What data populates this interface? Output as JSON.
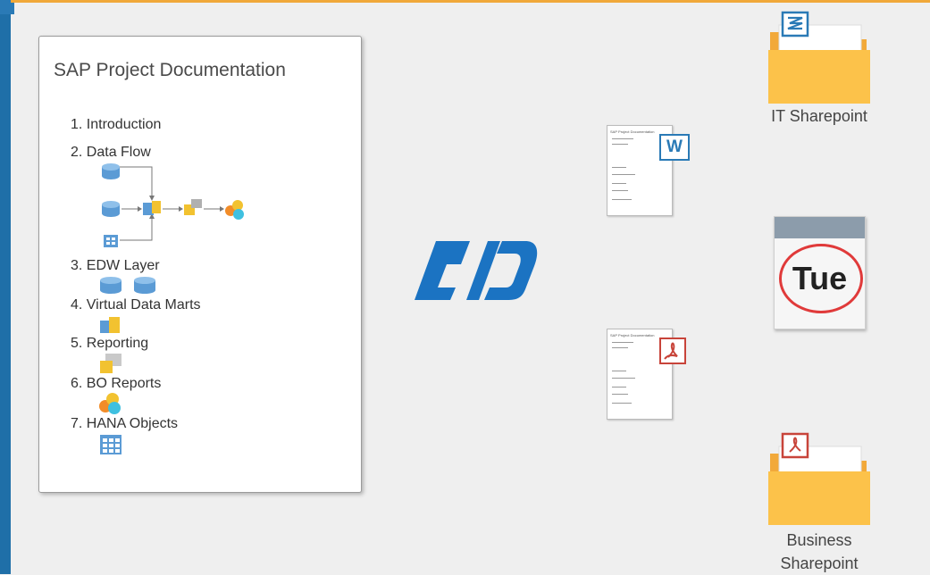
{
  "document": {
    "title": "SAP Project Documentation",
    "sections": [
      "1. Introduction",
      "2. Data Flow",
      "3. EDW Layer",
      "4. Virtual Data Marts",
      "5. Reporting",
      "6. BO Reports",
      "7. HANA Objects"
    ]
  },
  "thumbnails": {
    "title": "SAP Project Documentation",
    "word_badge": "W"
  },
  "targets": {
    "it_sharepoint": "IT Sharepoint",
    "calendar_day": "Tue",
    "business_sharepoint_line1": "Business",
    "business_sharepoint_line2": "Sharepoint"
  },
  "colors": {
    "accent_blue": "#1f6fa8",
    "folder_yellow": "#fcc24a",
    "word_blue": "#2a7ab6",
    "pdf_red": "#c8443a",
    "calendar_ring": "#e03a3a"
  }
}
